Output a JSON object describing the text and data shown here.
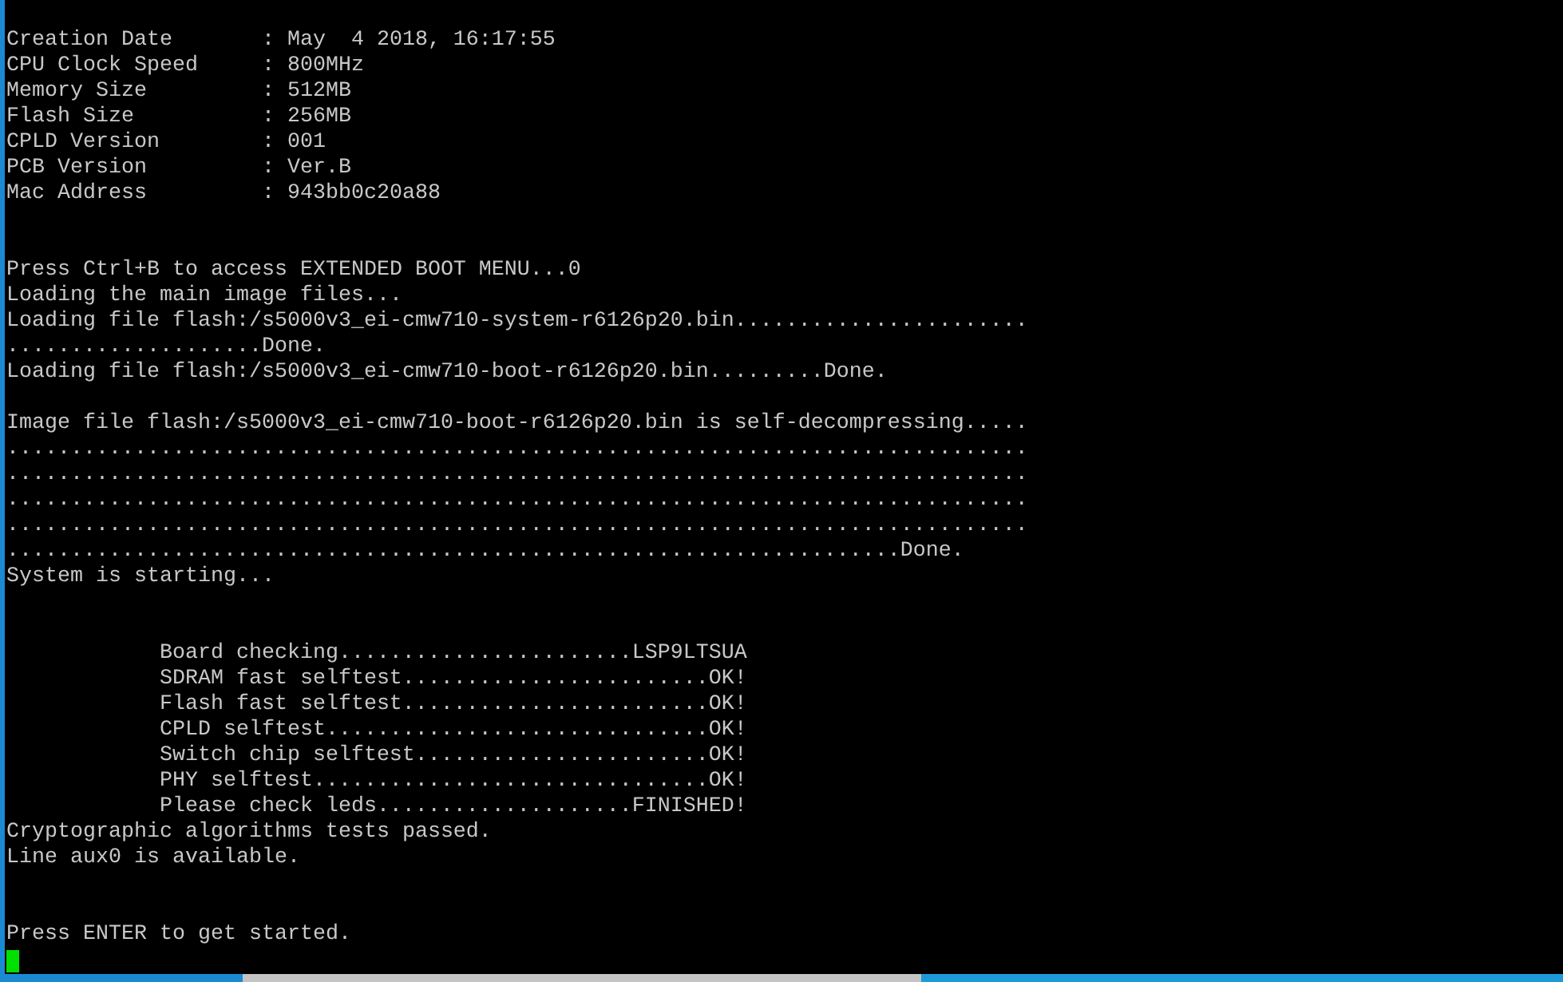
{
  "terminal": {
    "lines": [
      {
        "kind": "blank"
      },
      {
        "kind": "text",
        "text": "Creation Date       : May  4 2018, 16:17:55"
      },
      {
        "kind": "text",
        "text": "CPU Clock Speed     : 800MHz"
      },
      {
        "kind": "text",
        "text": "Memory Size         : 512MB"
      },
      {
        "kind": "text",
        "text": "Flash Size          : 256MB"
      },
      {
        "kind": "text",
        "text": "CPLD Version        : 001"
      },
      {
        "kind": "text",
        "text": "PCB Version         : Ver.B"
      },
      {
        "kind": "text",
        "text": "Mac Address         : 943bb0c20a88"
      },
      {
        "kind": "blank"
      },
      {
        "kind": "blank"
      },
      {
        "kind": "text",
        "text": "Press Ctrl+B to access EXTENDED BOOT MENU...0"
      },
      {
        "kind": "text",
        "text": "Loading the main image files..."
      },
      {
        "kind": "text",
        "text": "Loading file flash:/s5000v3_ei-cmw710-system-r6126p20.bin......................."
      },
      {
        "kind": "text",
        "text": "....................Done."
      },
      {
        "kind": "text",
        "text": "Loading file flash:/s5000v3_ei-cmw710-boot-r6126p20.bin.........Done."
      },
      {
        "kind": "blank"
      },
      {
        "kind": "text",
        "text": "Image file flash:/s5000v3_ei-cmw710-boot-r6126p20.bin is self-decompressing....."
      },
      {
        "kind": "text",
        "text": "................................................................................"
      },
      {
        "kind": "text",
        "text": "................................................................................"
      },
      {
        "kind": "text",
        "text": "................................................................................"
      },
      {
        "kind": "text",
        "text": "................................................................................"
      },
      {
        "kind": "text",
        "text": "......................................................................Done."
      },
      {
        "kind": "text",
        "text": "System is starting..."
      },
      {
        "kind": "blank"
      },
      {
        "kind": "blank"
      },
      {
        "kind": "indented",
        "text": "Board checking.......................LSP9LTSUA"
      },
      {
        "kind": "indented",
        "text": "SDRAM fast selftest........................OK!"
      },
      {
        "kind": "indented",
        "text": "Flash fast selftest........................OK!"
      },
      {
        "kind": "indented",
        "text": "CPLD selftest..............................OK!"
      },
      {
        "kind": "indented",
        "text": "Switch chip selftest.......................OK!"
      },
      {
        "kind": "indented",
        "text": "PHY selftest...............................OK!"
      },
      {
        "kind": "indented",
        "text": "Please check leds....................FINISHED!"
      },
      {
        "kind": "text",
        "text": "Cryptographic algorithms tests passed."
      },
      {
        "kind": "text",
        "text": "Line aux0 is available."
      },
      {
        "kind": "blank"
      },
      {
        "kind": "blank"
      },
      {
        "kind": "text",
        "text": "Press ENTER to get started."
      },
      {
        "kind": "cursor"
      }
    ]
  }
}
